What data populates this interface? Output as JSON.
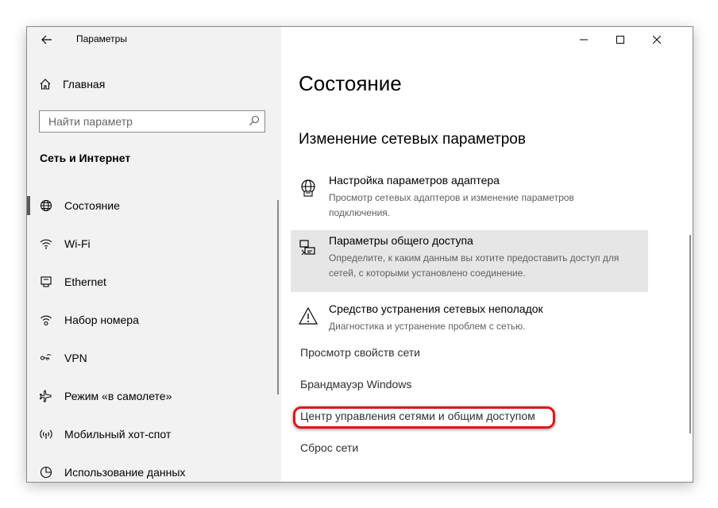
{
  "window": {
    "title": "Параметры"
  },
  "controls": {
    "minimize": "—",
    "maximize": "☐",
    "close": "✕"
  },
  "sidebar": {
    "home_label": "Главная",
    "search_placeholder": "Найти параметр",
    "section_heading": "Сеть и Интернет",
    "items": [
      {
        "label": "Состояние",
        "icon": "globe-icon",
        "active": true
      },
      {
        "label": "Wi-Fi",
        "icon": "wifi-icon",
        "active": false
      },
      {
        "label": "Ethernet",
        "icon": "ethernet-icon",
        "active": false
      },
      {
        "label": "Набор номера",
        "icon": "dialup-icon",
        "active": false
      },
      {
        "label": "VPN",
        "icon": "vpn-icon",
        "active": false
      },
      {
        "label": "Режим «в самолете»",
        "icon": "airplane-icon",
        "active": false
      },
      {
        "label": "Мобильный хот-спот",
        "icon": "hotspot-icon",
        "active": false
      },
      {
        "label": "Использование данных",
        "icon": "data-usage-icon",
        "active": false
      }
    ]
  },
  "main": {
    "title": "Состояние",
    "section_title": "Изменение сетевых параметров",
    "options": [
      {
        "title": "Настройка параметров адаптера",
        "description": "Просмотр сетевых адаптеров и изменение параметров подключения.",
        "icon": "adapter-icon"
      },
      {
        "title": "Параметры общего доступа",
        "description": "Определите, к каким данным вы хотите предоставить доступ для сетей, с которыми установлено соединение.",
        "icon": "sharing-icon"
      },
      {
        "title": "Средство устранения сетевых неполадок",
        "description": "Диагностика и устранение проблем с сетью.",
        "icon": "warning-icon"
      }
    ],
    "links": [
      "Просмотр свойств сети",
      "Брандмауэр Windows",
      "Центр управления сетями и общим доступом",
      "Сброс сети"
    ]
  },
  "colors": {
    "sidebar_bg": "#f2f2f2",
    "hover_bg": "#e6e6e6",
    "highlight": "#e0141b"
  }
}
